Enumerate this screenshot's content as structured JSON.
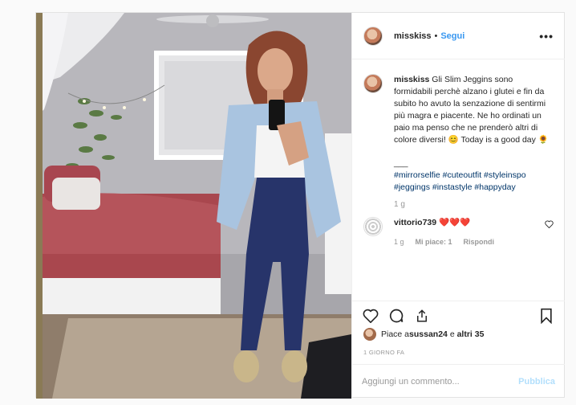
{
  "post": {
    "username": "misskiss",
    "dot": "•",
    "follow": "Segui",
    "more": "•••"
  },
  "caption": {
    "username": "misskiss",
    "text": "Gli Slim Jeggins sono formidabili perchè alzano i glutei e fin da subito ho avuto la senzazione di sentirmi più magra e piacente. Ne ho ordinati un paio ma penso che ne prenderò altri di colore diversi! 😊 Today is a good day 🌻",
    "separator": "___",
    "hashtags": "#mirrorselfie #cuteoutfit #styleinspo #jeggings #instastyle #happyday",
    "age": "1 g"
  },
  "comment": {
    "username": "vittorio739",
    "text": "❤️❤️❤️",
    "age": "1 g",
    "likes": "Mi piace: 1",
    "reply": "Rispondi"
  },
  "likes": {
    "prefix": "Piace a ",
    "user": "sussan24",
    "middle": " e ",
    "others": "altri 35"
  },
  "date": "1 GIORNO FA",
  "add_comment": {
    "placeholder": "Aggiungi un commento...",
    "publish": "Pubblica"
  },
  "icons": {
    "like": "heart-icon",
    "comment": "comment-bubble-icon",
    "share": "share-icon",
    "save": "bookmark-icon"
  }
}
